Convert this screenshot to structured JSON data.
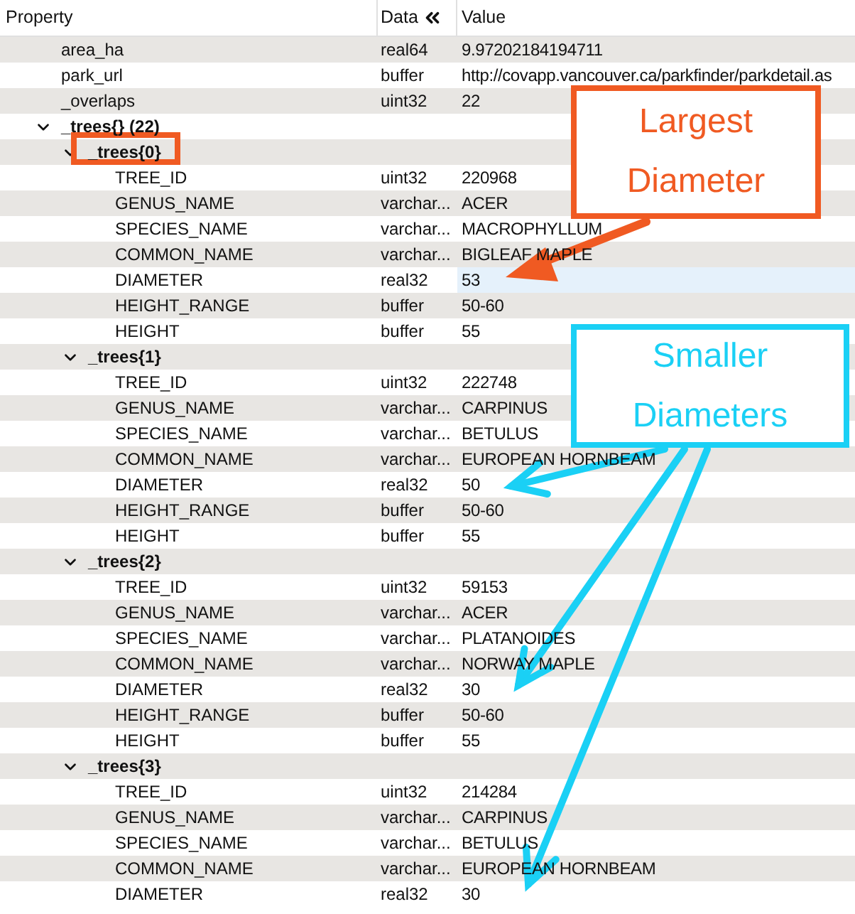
{
  "columns": [
    "Property",
    "Data",
    "Value"
  ],
  "rows": [
    {
      "property": "area_ha",
      "data": "real64",
      "value": "9.97202184194711",
      "selected": false
    },
    {
      "property": "park_url",
      "data": "buffer",
      "value": "http://covapp.vancouver.ca/parkfinder/parkdetail.as",
      "selected": false
    },
    {
      "property": "_overlaps",
      "data": "uint32",
      "value": "22",
      "selected": false
    },
    {
      "property": "_trees{} (22)",
      "expanded": true,
      "selected": false,
      "children": [
        {
          "property": "_trees{0}",
          "expanded": true,
          "selected": false,
          "children": [
            {
              "property": "TREE_ID",
              "data": "uint32",
              "value": "220968",
              "selected": false
            },
            {
              "property": "GENUS_NAME",
              "data": "varchar...",
              "value": "ACER",
              "selected": false
            },
            {
              "property": "SPECIES_NAME",
              "data": "varchar...",
              "value": "MACROPHYLLUM",
              "selected": false
            },
            {
              "property": "COMMON_NAME",
              "data": "varchar...",
              "value": "BIGLEAF MAPLE",
              "selected": false
            },
            {
              "property": "DIAMETER",
              "data": "real32",
              "value": "53",
              "selected": true
            },
            {
              "property": "HEIGHT_RANGE",
              "data": "buffer",
              "value": "50-60",
              "selected": false
            },
            {
              "property": "HEIGHT",
              "data": "buffer",
              "value": "55",
              "selected": false
            }
          ]
        },
        {
          "property": "_trees{1}",
          "expanded": true,
          "selected": false,
          "children": [
            {
              "property": "TREE_ID",
              "data": "uint32",
              "value": "222748",
              "selected": false
            },
            {
              "property": "GENUS_NAME",
              "data": "varchar...",
              "value": "CARPINUS",
              "selected": false
            },
            {
              "property": "SPECIES_NAME",
              "data": "varchar...",
              "value": "BETULUS",
              "selected": false
            },
            {
              "property": "COMMON_NAME",
              "data": "varchar...",
              "value": "EUROPEAN HORNBEAM",
              "selected": false
            },
            {
              "property": "DIAMETER",
              "data": "real32",
              "value": "50",
              "selected": false
            },
            {
              "property": "HEIGHT_RANGE",
              "data": "buffer",
              "value": "50-60",
              "selected": false
            },
            {
              "property": "HEIGHT",
              "data": "buffer",
              "value": "55",
              "selected": false
            }
          ]
        },
        {
          "property": "_trees{2}",
          "expanded": true,
          "selected": false,
          "children": [
            {
              "property": "TREE_ID",
              "data": "uint32",
              "value": "59153",
              "selected": false
            },
            {
              "property": "GENUS_NAME",
              "data": "varchar...",
              "value": "ACER",
              "selected": false
            },
            {
              "property": "SPECIES_NAME",
              "data": "varchar...",
              "value": "PLATANOIDES",
              "selected": false
            },
            {
              "property": "COMMON_NAME",
              "data": "varchar...",
              "value": "NORWAY MAPLE",
              "selected": false
            },
            {
              "property": "DIAMETER",
              "data": "real32",
              "value": "30",
              "selected": false
            },
            {
              "property": "HEIGHT_RANGE",
              "data": "buffer",
              "value": "50-60",
              "selected": false
            },
            {
              "property": "HEIGHT",
              "data": "buffer",
              "value": "55",
              "selected": false
            }
          ]
        },
        {
          "property": "_trees{3}",
          "expanded": true,
          "selected": false,
          "children": [
            {
              "property": "TREE_ID",
              "data": "uint32",
              "value": "214284",
              "selected": false
            },
            {
              "property": "GENUS_NAME",
              "data": "varchar...",
              "value": "CARPINUS",
              "selected": false
            },
            {
              "property": "SPECIES_NAME",
              "data": "varchar...",
              "value": "BETULUS",
              "selected": false
            },
            {
              "property": "COMMON_NAME",
              "data": "varchar...",
              "value": "EUROPEAN HORNBEAM",
              "selected": false
            },
            {
              "property": "DIAMETER",
              "data": "real32",
              "value": "30",
              "selected": false
            }
          ]
        }
      ]
    }
  ],
  "annotations": [
    {
      "lines": [
        "Largest",
        "Diameter"
      ],
      "color": "#f05a22"
    },
    {
      "lines": [
        "Smaller",
        "Diameters"
      ],
      "color": "#1ad0f5"
    }
  ]
}
